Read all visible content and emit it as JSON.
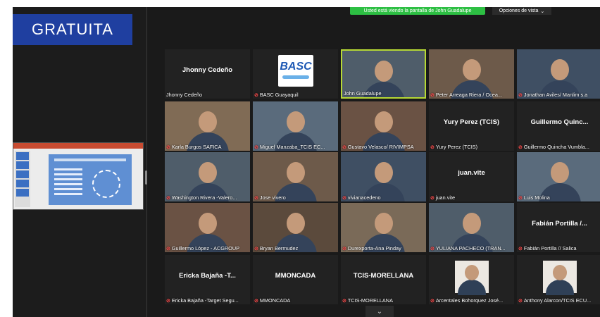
{
  "promo": {
    "label": "GRATUITA"
  },
  "top_bar": {
    "share_notice": "Usted está viendo la pantalla de John Guadalupe",
    "view_options": "Opciones de vista",
    "view_options_chevron": "⌄"
  },
  "shared_screen": {
    "icon": "presentation-thumbnail"
  },
  "participants": [
    {
      "tile_text": "Jhonny Cedeño",
      "name": "Jhonny Cedeño",
      "muted": false,
      "video": false
    },
    {
      "logo": "BASC",
      "name": "BASC Guayaquil",
      "muted": true,
      "video": false
    },
    {
      "name": "John Guadalupe",
      "muted": false,
      "video": true,
      "active_speaker": true
    },
    {
      "name": "Peter Arreaga Riera / Ocea...",
      "muted": true,
      "video": true
    },
    {
      "name": "Jonathan Aviles/ Manlim s.a",
      "muted": true,
      "video": true
    },
    {
      "name": "Karla Burgos SAFICA",
      "muted": true,
      "video": true
    },
    {
      "name": "Miguel Manzaba_TCIS EC...",
      "muted": true,
      "video": true
    },
    {
      "name": "Gustavo Velasco/ RIVIMPSA",
      "muted": true,
      "video": true
    },
    {
      "tile_text": "Yury Perez (TCIS)",
      "name": "Yury Perez (TCIS)",
      "muted": true,
      "video": false
    },
    {
      "tile_text": "Guillermo Quinc...",
      "name": "Guillermo Quincha Vumbla...",
      "muted": true,
      "video": false
    },
    {
      "name": "Washington Rivera -Valero...",
      "muted": true,
      "video": true
    },
    {
      "name": "Jose vivero",
      "muted": true,
      "video": true
    },
    {
      "name": "vivianacedeno",
      "muted": true,
      "video": true
    },
    {
      "tile_text": "juan.vite",
      "name": "juan.vite",
      "muted": true,
      "video": false
    },
    {
      "name": "Luis Molina",
      "muted": true,
      "video": true
    },
    {
      "name": "Guillermo López - ACGROUP",
      "muted": true,
      "video": true
    },
    {
      "name": "Bryan Bermudez",
      "muted": true,
      "video": true
    },
    {
      "name": "Durexporta-Ana Pinday",
      "muted": true,
      "video": true
    },
    {
      "name": "YULIANA PACHECO (TRAN...",
      "muted": true,
      "video": true
    },
    {
      "tile_text": "Fabián Portilla /...",
      "name": "Fabián Portilla // Salica",
      "muted": true,
      "video": false
    },
    {
      "tile_text": "Ericka Bajaña -T...",
      "name": "Ericka Bajaña -Target Segu...",
      "muted": true,
      "video": false
    },
    {
      "tile_text": "MMONCADA",
      "name": "MMONCADA",
      "muted": true,
      "video": false
    },
    {
      "tile_text": "TCIS-MORELLANA",
      "name": "TCIS-MORELLANA",
      "muted": true,
      "video": false
    },
    {
      "name": "Arcentales Bohorquez José...",
      "muted": true,
      "video": true,
      "small_video": true
    },
    {
      "name": "Anthony Alarcon/TCIS ECU...",
      "muted": true,
      "video": true,
      "small_video": true
    }
  ],
  "colors": {
    "active_speaker_border": "#b7d934",
    "muted_icon": "#ff4f4f",
    "share_banner": "#2dbf43",
    "promo_badge": "#1f3fa0"
  }
}
